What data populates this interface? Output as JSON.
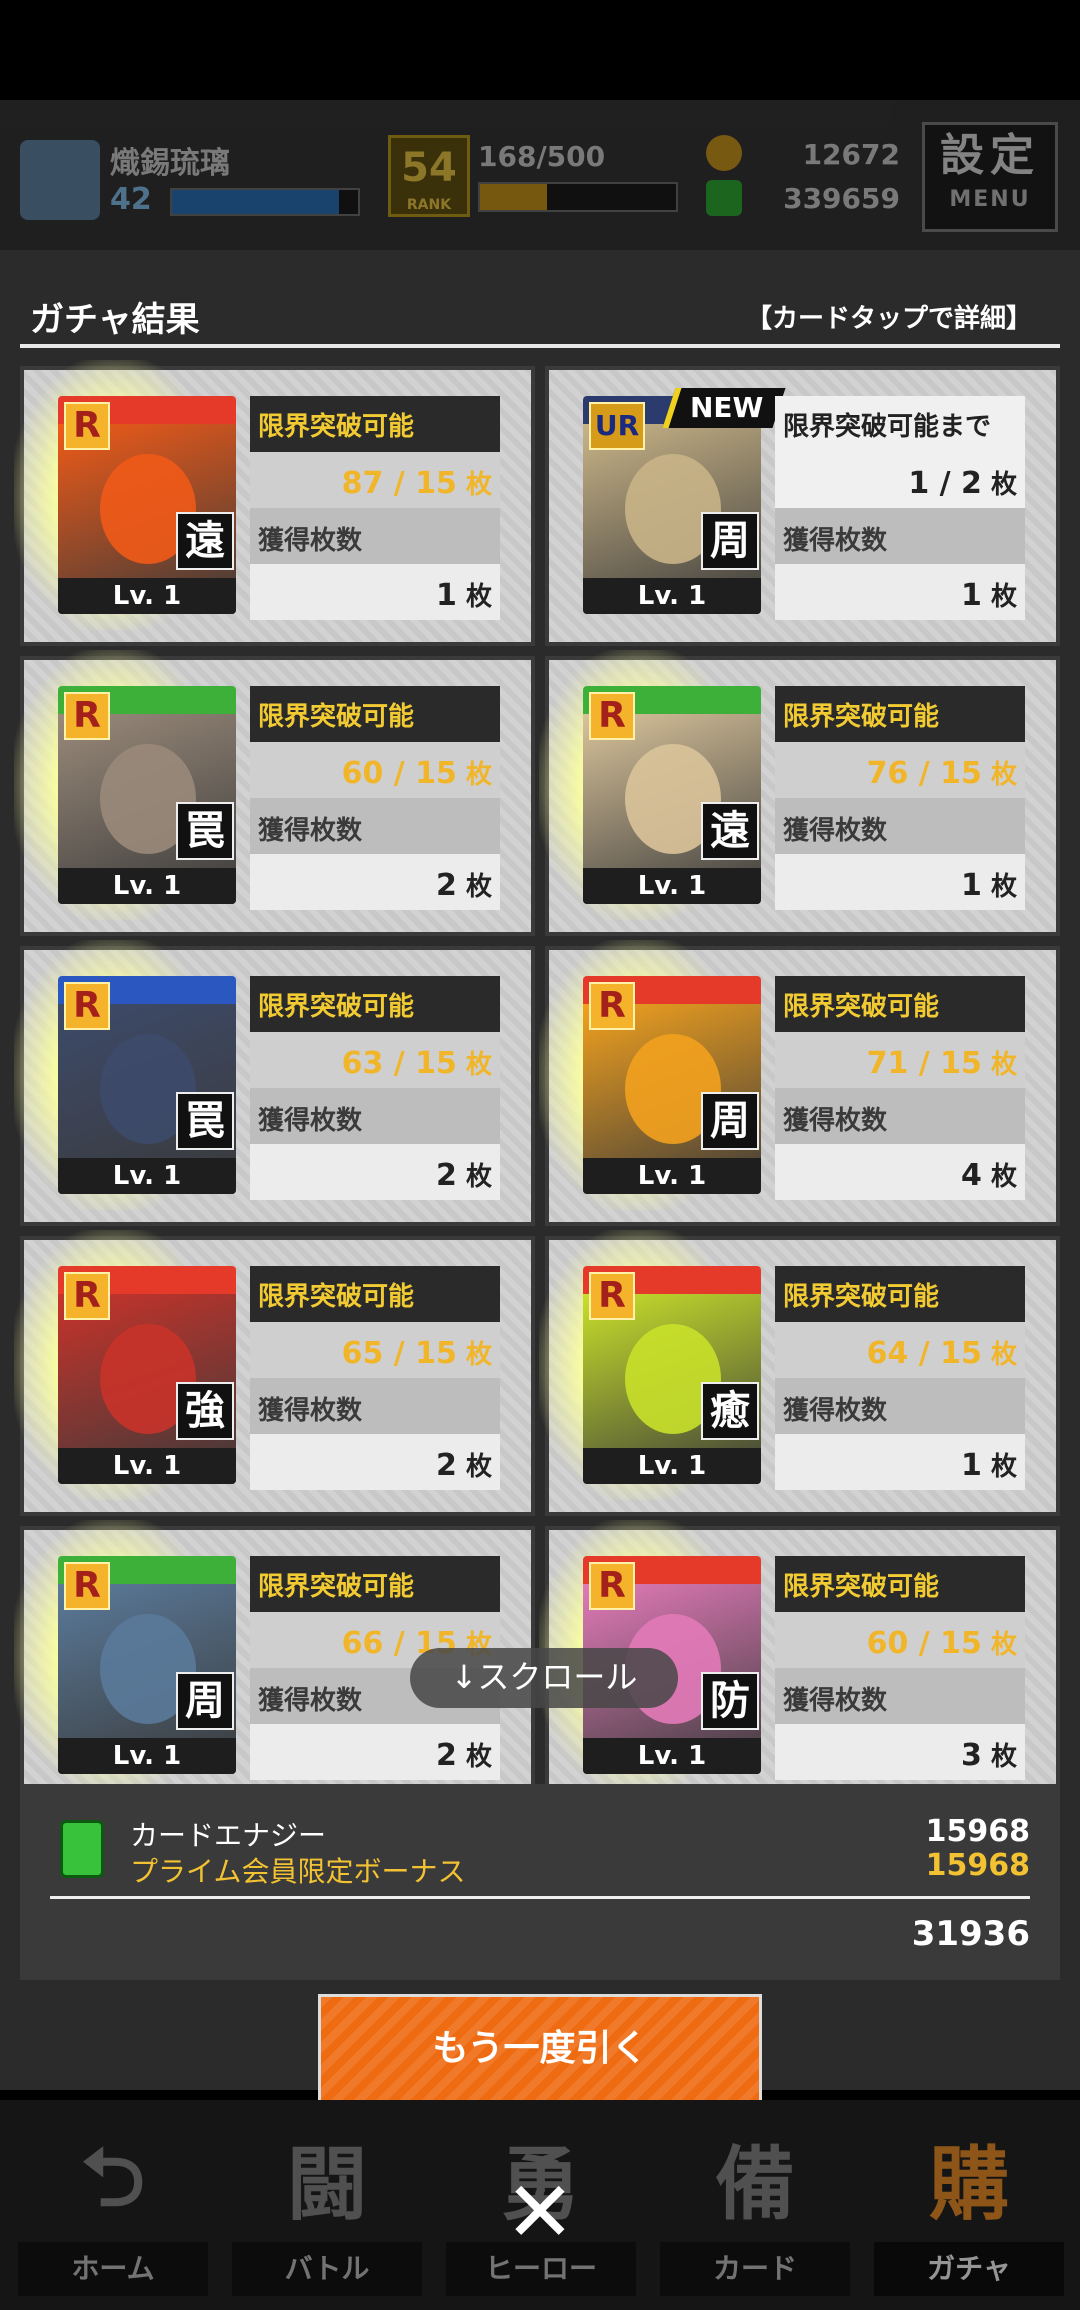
{
  "hud": {
    "player_name": "熾錫琉璃",
    "player_level": "42",
    "xp_fill": 0.9,
    "rank_value": "54",
    "rank_label": "RANK",
    "stamina": "168/500",
    "stamina_fill": 0.34,
    "coins": "12672",
    "gems": "339659",
    "settings_label": "設定",
    "menu_label": "MENU"
  },
  "modal": {
    "title": "ガチャ結果",
    "hint": "【カードタップで詳細】",
    "scroll_hint": "↓スクロール",
    "count_unit": "枚",
    "acquired_label": "獲得枚数",
    "cards": [
      {
        "rarity": "R",
        "type": "遠",
        "level": "Lv. 1",
        "label": "限界突破可能",
        "progress": "87 / 15",
        "acquired": "1",
        "band": "#e53a2a",
        "art": "#f05a18"
      },
      {
        "rarity": "UR",
        "type": "周",
        "level": "Lv. 1",
        "label": "限界突破可能まで",
        "progress": "1 / 2",
        "acquired": "1",
        "band": "#2b3b6e",
        "art": "#c9b487",
        "new": "NEW"
      },
      {
        "rarity": "R",
        "type": "罠",
        "level": "Lv. 1",
        "label": "限界突破可能",
        "progress": "60 / 15",
        "acquired": "2",
        "band": "#3db03a",
        "art": "#9a8a7a"
      },
      {
        "rarity": "R",
        "type": "遠",
        "level": "Lv. 1",
        "label": "限界突破可能",
        "progress": "76 / 15",
        "acquired": "1",
        "band": "#3db03a",
        "art": "#d9c39a"
      },
      {
        "rarity": "R",
        "type": "罠",
        "level": "Lv. 1",
        "label": "限界突破可能",
        "progress": "63 / 15",
        "acquired": "2",
        "band": "#2a58c0",
        "art": "#3d4a6a"
      },
      {
        "rarity": "R",
        "type": "周",
        "level": "Lv. 1",
        "label": "限界突破可能",
        "progress": "71 / 15",
        "acquired": "4",
        "band": "#e53a2a",
        "art": "#f2a11e"
      },
      {
        "rarity": "R",
        "type": "強",
        "level": "Lv. 1",
        "label": "限界突破可能",
        "progress": "65 / 15",
        "acquired": "2",
        "band": "#e53a2a",
        "art": "#c8332a"
      },
      {
        "rarity": "R",
        "type": "癒",
        "level": "Lv. 1",
        "label": "限界突破可能",
        "progress": "64 / 15",
        "acquired": "1",
        "band": "#e53a2a",
        "art": "#c8e02a"
      },
      {
        "rarity": "R",
        "type": "周",
        "level": "Lv. 1",
        "label": "限界突破可能",
        "progress": "66 / 15",
        "acquired": "2",
        "band": "#3db03a",
        "art": "#5a7a9a"
      },
      {
        "rarity": "R",
        "type": "防",
        "level": "Lv. 1",
        "label": "限界突破可能",
        "progress": "60 / 15",
        "acquired": "3",
        "band": "#e53a2a",
        "art": "#e27ab8"
      }
    ]
  },
  "energy": {
    "label": "カードエナジー",
    "bonus_label": "プライム会員限定ボーナス",
    "value": "15968",
    "bonus_value": "15968",
    "total": "31936"
  },
  "draw_again_label": "もう一度引く",
  "nav": {
    "tabs": [
      {
        "glyph": "⮌",
        "label": "ホーム"
      },
      {
        "glyph": "闘",
        "label": "バトル"
      },
      {
        "glyph": "勇",
        "label": "ヒーロー"
      },
      {
        "glyph": "備",
        "label": "カード"
      },
      {
        "glyph": "購",
        "label": "ガチャ"
      }
    ],
    "close_glyph": "✕"
  }
}
